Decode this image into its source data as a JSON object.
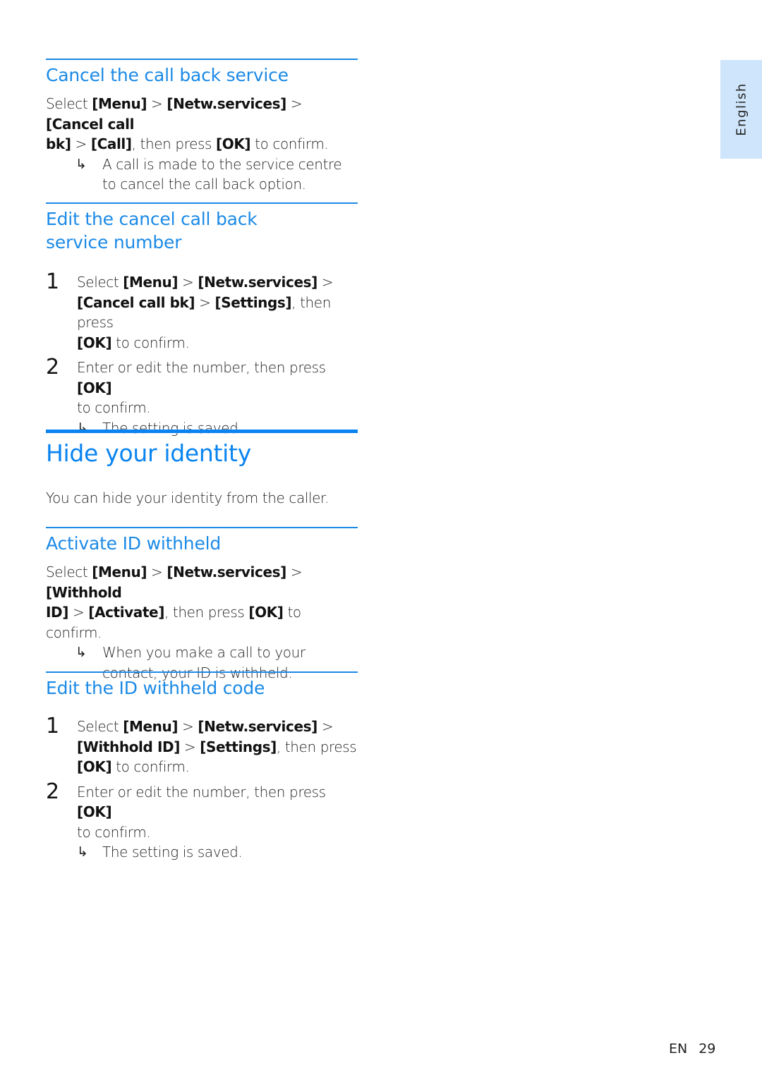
{
  "side_tab": {
    "language": "English"
  },
  "sections": {
    "cancel_call_back": {
      "heading": "Cancel the call back service",
      "select": "Select ",
      "menu": "[Menu]",
      "sep": " > ",
      "netw": "[Netw.services]",
      "item": "[Cancel call bk]",
      "item_a": "[Cancel call",
      "item_b": "bk]",
      "action": "[Call]",
      "then_press": ", then press ",
      "ok": "[OK]",
      "to_confirm": " to confirm.",
      "result": "A call is made to the service centre to cancel the call back option."
    },
    "edit_cancel_number": {
      "heading": "Edit the cancel call back service number",
      "steps": [
        {
          "num": "1",
          "select": "Select ",
          "menu": "[Menu]",
          "sep": " > ",
          "netw": "[Netw.services]",
          "item": "[Cancel call bk]",
          "action": "[Settings]",
          "then_press": ", then press ",
          "ok": "[OK]",
          "to_confirm": " to confirm."
        },
        {
          "num": "2",
          "text": "Enter or edit the number, then press ",
          "ok": "[OK]",
          "to_confirm": " to confirm.",
          "result": "The setting is saved."
        }
      ]
    },
    "hide_identity": {
      "title": "Hide your identity",
      "intro": "You can hide your identity from the caller."
    },
    "activate_id": {
      "heading": "Activate ID withheld",
      "select": "Select ",
      "menu": "[Menu]",
      "sep": " > ",
      "netw": "[Netw.services]",
      "item_a": "[Withhold",
      "item_b": "ID]",
      "action": "[Activate]",
      "then_press": ", then press ",
      "ok": "[OK]",
      "to_confirm": " to confirm.",
      "result": "When you make a call to your contact, your ID is withheld."
    },
    "edit_id_code": {
      "heading": "Edit the ID withheld code",
      "steps": [
        {
          "num": "1",
          "select": "Select ",
          "menu": "[Menu]",
          "sep": " > ",
          "netw": "[Netw.services]",
          "item": "[Withhold ID]",
          "action": "[Settings]",
          "then_press": ", then press ",
          "ok": "[OK]",
          "to_confirm": " to confirm."
        },
        {
          "num": "2",
          "text": "Enter or edit the number, then press ",
          "ok": "[OK]",
          "to_confirm": " to confirm.",
          "result": "The setting is saved."
        }
      ]
    }
  },
  "result_arrow": "↳",
  "footer": {
    "lang": "EN",
    "page": "29"
  }
}
